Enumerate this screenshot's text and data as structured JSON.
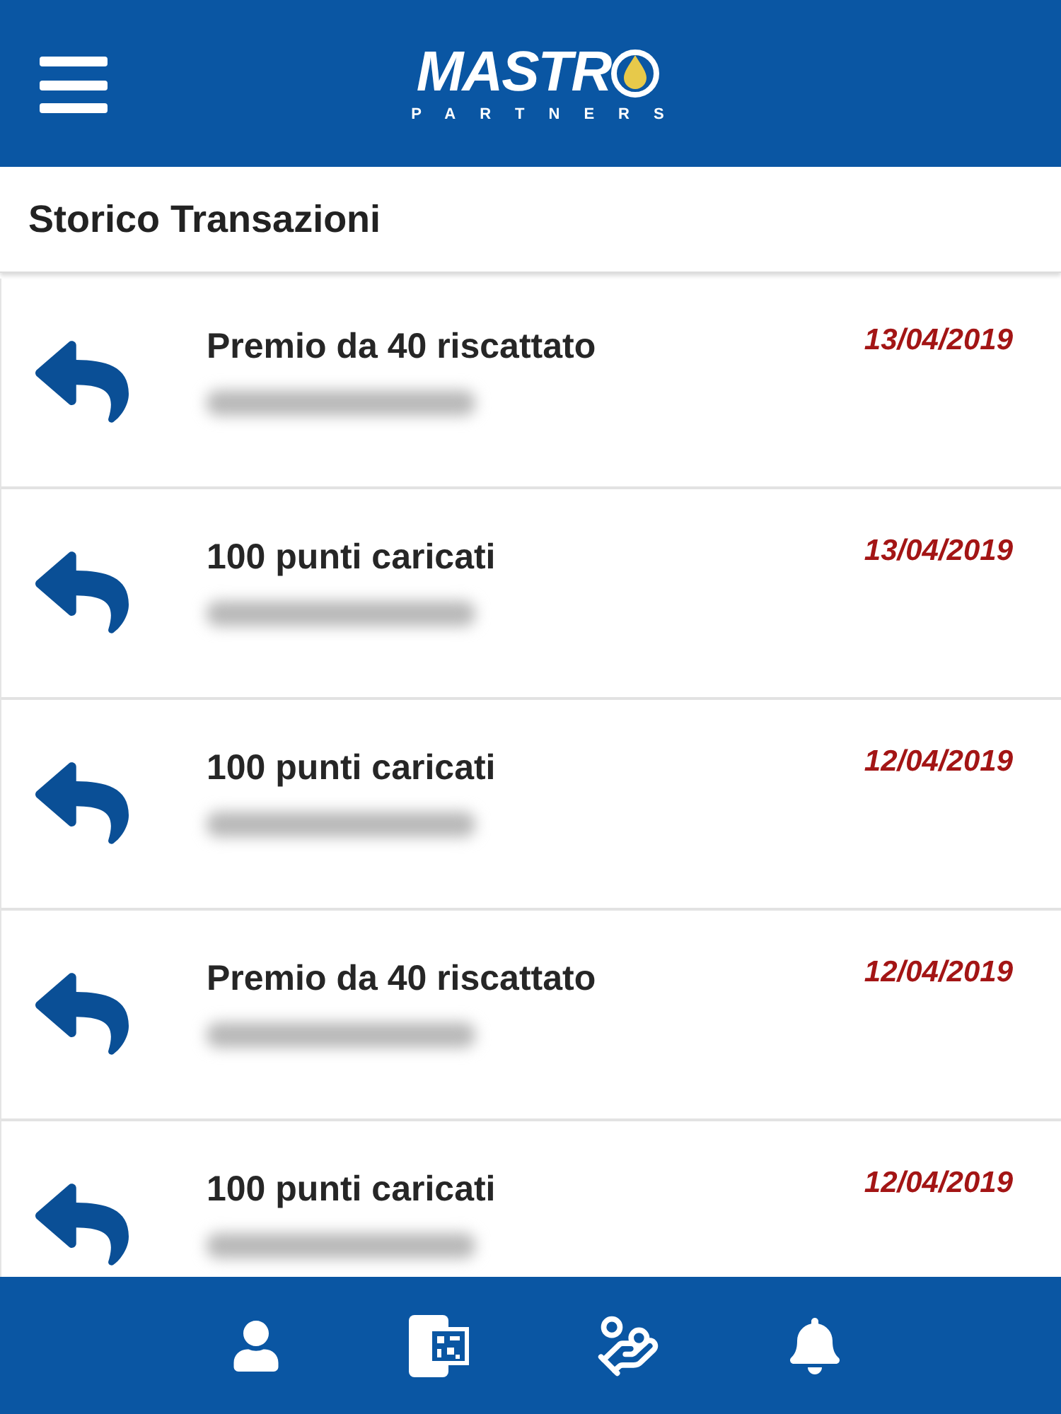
{
  "header": {
    "logo": {
      "word": "MASTR",
      "tagline": "PARTNERS"
    }
  },
  "page_title": "Storico Transazioni",
  "transactions": [
    {
      "title": "Premio da 40 riscattato",
      "date": "13/04/2019"
    },
    {
      "title": "100 punti caricati",
      "date": "13/04/2019"
    },
    {
      "title": "100 punti caricati",
      "date": "12/04/2019"
    },
    {
      "title": "Premio da 40 riscattato",
      "date": "12/04/2019"
    },
    {
      "title": "100 punti caricati",
      "date": "12/04/2019"
    }
  ]
}
